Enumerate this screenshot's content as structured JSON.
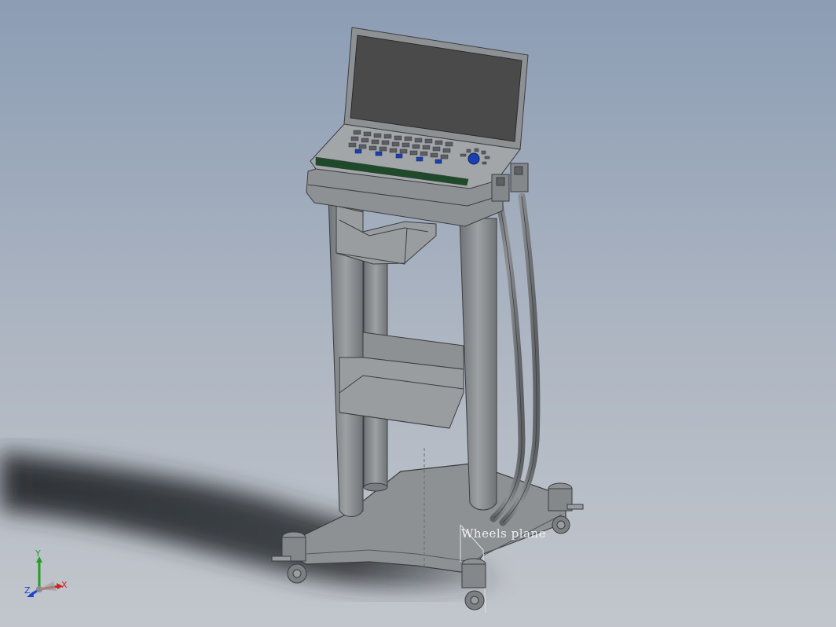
{
  "viewport": {
    "background_top": "#8c9db4",
    "background_bottom": "#c2c6cc"
  },
  "model": {
    "description_icon": "medical-cart-model",
    "plane_label": "Wheels plane",
    "body_color": "#8e9194",
    "screen_color": "#4a4a4a",
    "key_accent_color": "#1a3fb0",
    "strip_color": "#1e4a2a"
  },
  "triad": {
    "x_label": "X",
    "y_label": "Y",
    "z_label": "Z",
    "x_color": "#d02020",
    "y_color": "#20a020",
    "z_color": "#2040d0"
  }
}
